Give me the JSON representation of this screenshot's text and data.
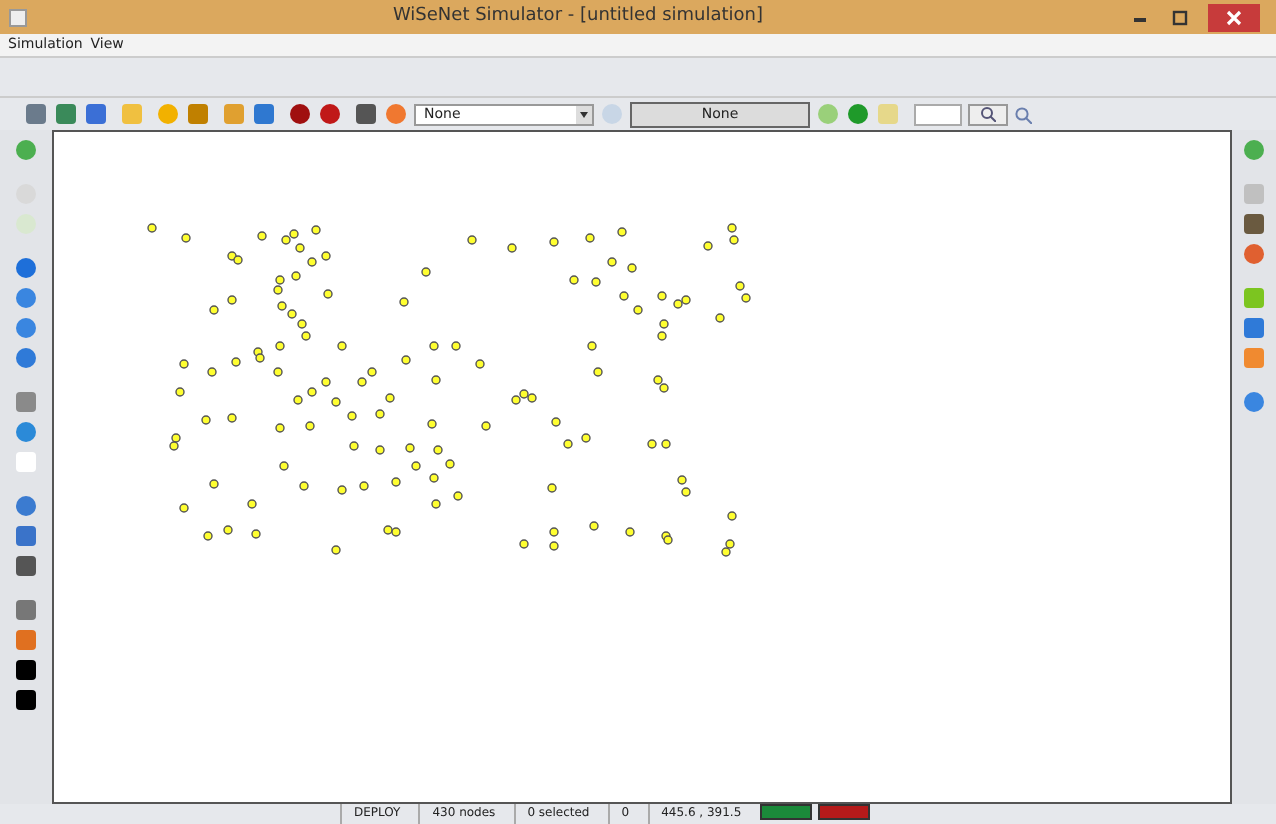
{
  "window": {
    "title": "WiSeNet Simulator - [untitled simulation]"
  },
  "menu": [
    "Simulation",
    "View"
  ],
  "toolbar": {
    "dropdown": {
      "value": "None"
    },
    "display": "None"
  },
  "status_bar": [
    "DEPLOY",
    "430 nodes",
    "0 selected",
    "0",
    "445.6 , 391.5"
  ]
}
